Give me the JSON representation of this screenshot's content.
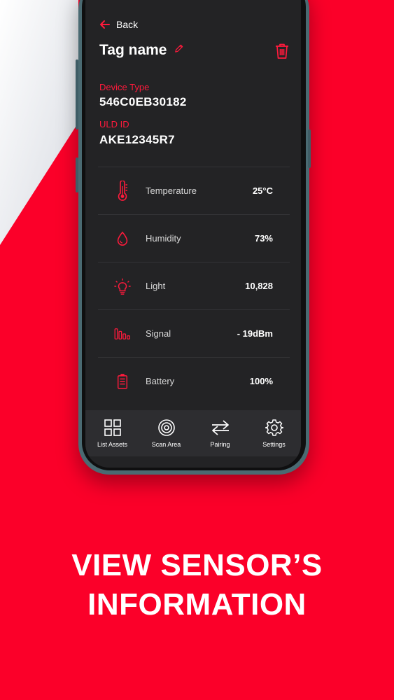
{
  "colors": {
    "accent": "#ff1a3c",
    "background": "#fb0029",
    "screen": "#232325"
  },
  "header": {
    "back_label": "Back",
    "title": "Tag name"
  },
  "device": {
    "type_label": "Device Type",
    "type_value": "546C0EB30182",
    "uld_label": "ULD ID",
    "uld_value": "AKE12345R7"
  },
  "sensors": [
    {
      "icon": "thermometer-icon",
      "name": "Temperature",
      "value": "25",
      "unit": "°C"
    },
    {
      "icon": "water-drop-icon",
      "name": "Humidity",
      "value": "73%"
    },
    {
      "icon": "light-bulb-icon",
      "name": "Light",
      "value": "10,828"
    },
    {
      "icon": "signal-bars-icon",
      "name": "Signal",
      "value": "- 19dBm"
    },
    {
      "icon": "battery-icon",
      "name": "Battery",
      "value": "100%"
    }
  ],
  "nav": [
    {
      "icon": "grid-icon",
      "label": "List Assets"
    },
    {
      "icon": "radar-icon",
      "label": "Scan Area"
    },
    {
      "icon": "swap-arrows-icon",
      "label": "Pairing"
    },
    {
      "icon": "gear-icon",
      "label": "Settings"
    }
  ],
  "promo": {
    "line1": "VIEW SENSOR’S",
    "line2": "INFORMATION"
  }
}
